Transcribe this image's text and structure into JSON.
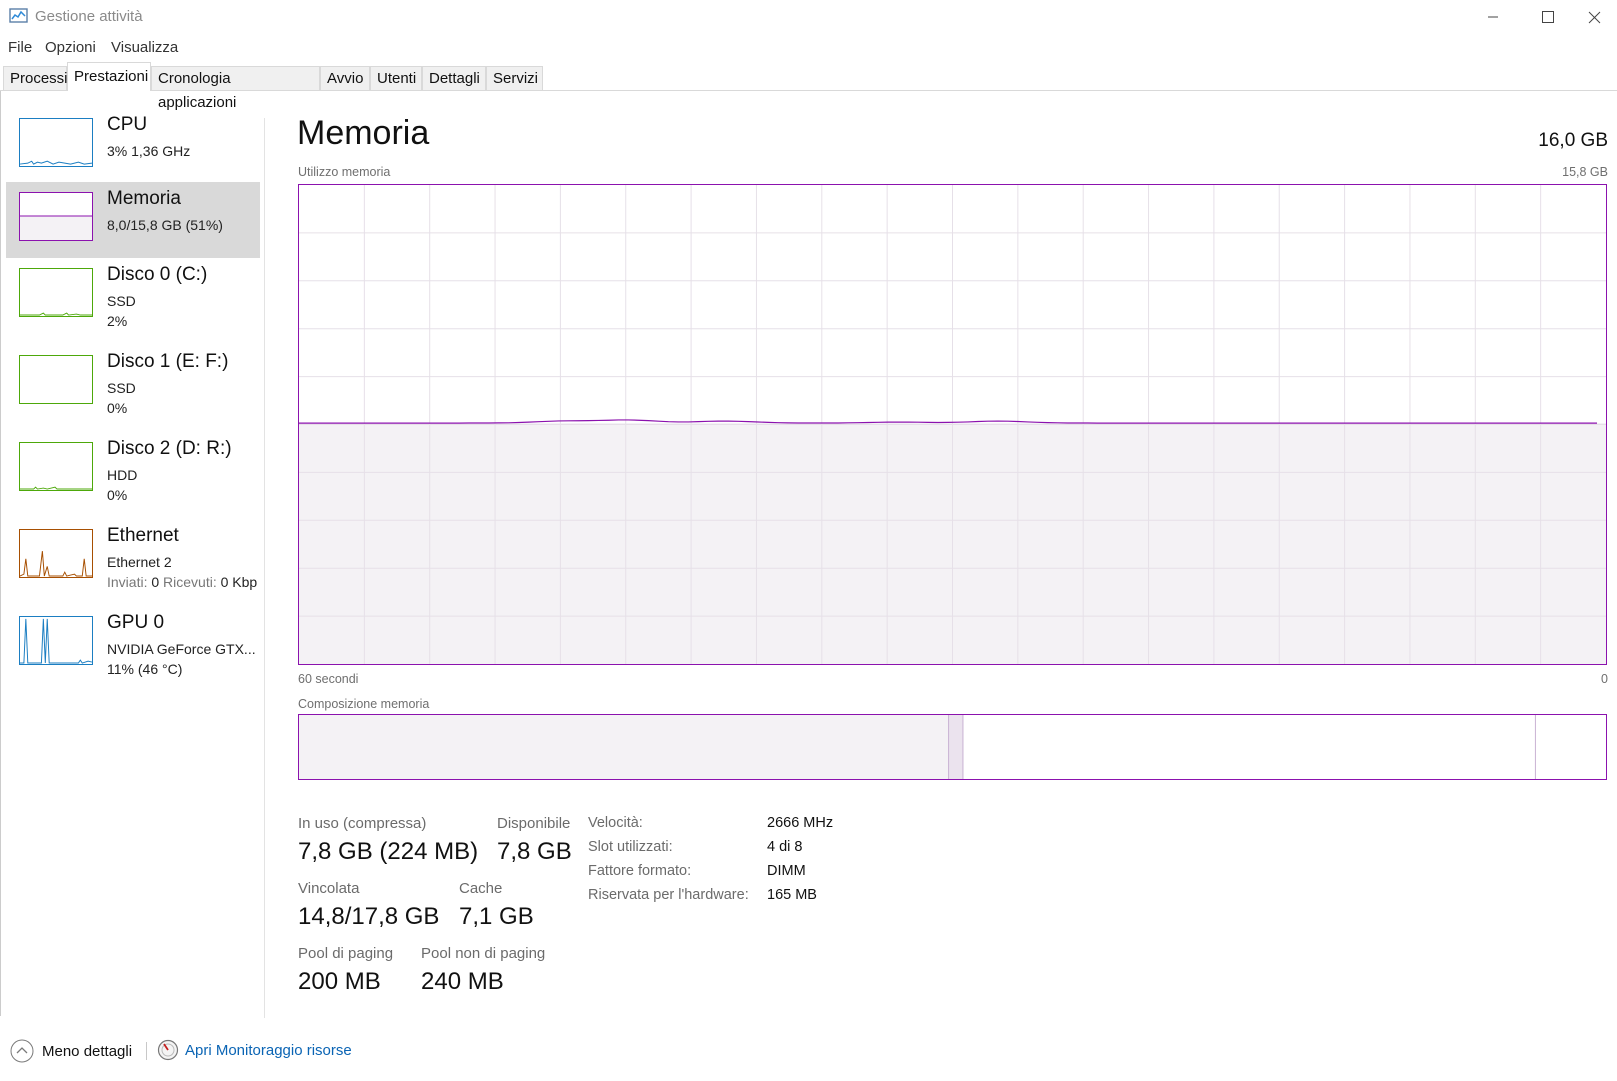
{
  "window": {
    "title": "Gestione attività",
    "controls": {
      "minimize_icon": "minimize-icon",
      "maximize_icon": "maximize-icon",
      "close_icon": "close-icon"
    }
  },
  "menu": [
    "File",
    "Opzioni",
    "Visualizza"
  ],
  "tabs": [
    {
      "label": "Processi",
      "active": false
    },
    {
      "label": "Prestazioni",
      "active": true
    },
    {
      "label": "Cronologia applicazioni",
      "active": false
    },
    {
      "label": "Avvio",
      "active": false
    },
    {
      "label": "Utenti",
      "active": false
    },
    {
      "label": "Dettagli",
      "active": false
    },
    {
      "label": "Servizi",
      "active": false
    }
  ],
  "sidebar": {
    "items": [
      {
        "title": "CPU",
        "lines": [
          "3%  1,36 GHz"
        ],
        "color": "#1b7ec2",
        "selected": false
      },
      {
        "title": "Memoria",
        "lines": [
          "8,0/15,8 GB (51%)"
        ],
        "color": "#8b12ae",
        "selected": true
      },
      {
        "title": "Disco 0 (C:)",
        "lines": [
          "SSD",
          "2%"
        ],
        "color": "#4da80a",
        "selected": false
      },
      {
        "title": "Disco 1 (E: F:)",
        "lines": [
          "SSD",
          "0%"
        ],
        "color": "#4da80a",
        "selected": false
      },
      {
        "title": "Disco 2 (D: R:)",
        "lines": [
          "HDD",
          "0%"
        ],
        "color": "#4da80a",
        "selected": false
      },
      {
        "title": "Ethernet",
        "lines": [
          "Ethernet 2"
        ],
        "throughput": {
          "sent_label": "Inviati:",
          "sent_value": "0",
          "recv_label": "Ricevuti:",
          "recv_value": "0 Kbp"
        },
        "color": "#a74f01",
        "selected": false
      },
      {
        "title": "GPU 0",
        "lines": [
          "NVIDIA GeForce GTX...",
          "11% (46 °C)"
        ],
        "color": "#1b7ec2",
        "selected": false
      }
    ]
  },
  "main": {
    "title": "Memoria",
    "total": "16,0 GB",
    "graph_label": "Utilizzo memoria",
    "graph_max": "15,8 GB",
    "time_left": "60 secondi",
    "time_right": "0",
    "composition_label": "Composizione memoria",
    "usage_fraction": 0.503,
    "composition": {
      "in_use_fraction": 0.497,
      "modified_fraction": 0.011,
      "standby_fraction": 0.438
    },
    "stats": {
      "in_use_label": "In uso (compressa)",
      "in_use_value": "7,8 GB (224 MB)",
      "available_label": "Disponibile",
      "available_value": "7,8 GB",
      "committed_label": "Vincolata",
      "committed_value": "14,8/17,8 GB",
      "cache_label": "Cache",
      "cache_value": "7,1 GB",
      "paged_label": "Pool di paging",
      "paged_value": "200 MB",
      "nonpaged_label": "Pool non di paging",
      "nonpaged_value": "240 MB"
    },
    "details": [
      {
        "label": "Velocità:",
        "value": "2666 MHz"
      },
      {
        "label": "Slot utilizzati:",
        "value": "4 di 8"
      },
      {
        "label": "Fattore formato:",
        "value": "DIMM"
      },
      {
        "label": "Riservata per l'hardware:",
        "value": "165 MB"
      }
    ]
  },
  "footer": {
    "less_details": "Meno dettagli",
    "open_monitor": "Apri Monitoraggio risorse",
    "less_details_icon": "chevron-up-icon",
    "monitor_icon": "resource-monitor-icon"
  },
  "colors": {
    "memory": "#8b12ae",
    "memory_fill": "#f4f2f5",
    "link": "#0a64b4"
  }
}
